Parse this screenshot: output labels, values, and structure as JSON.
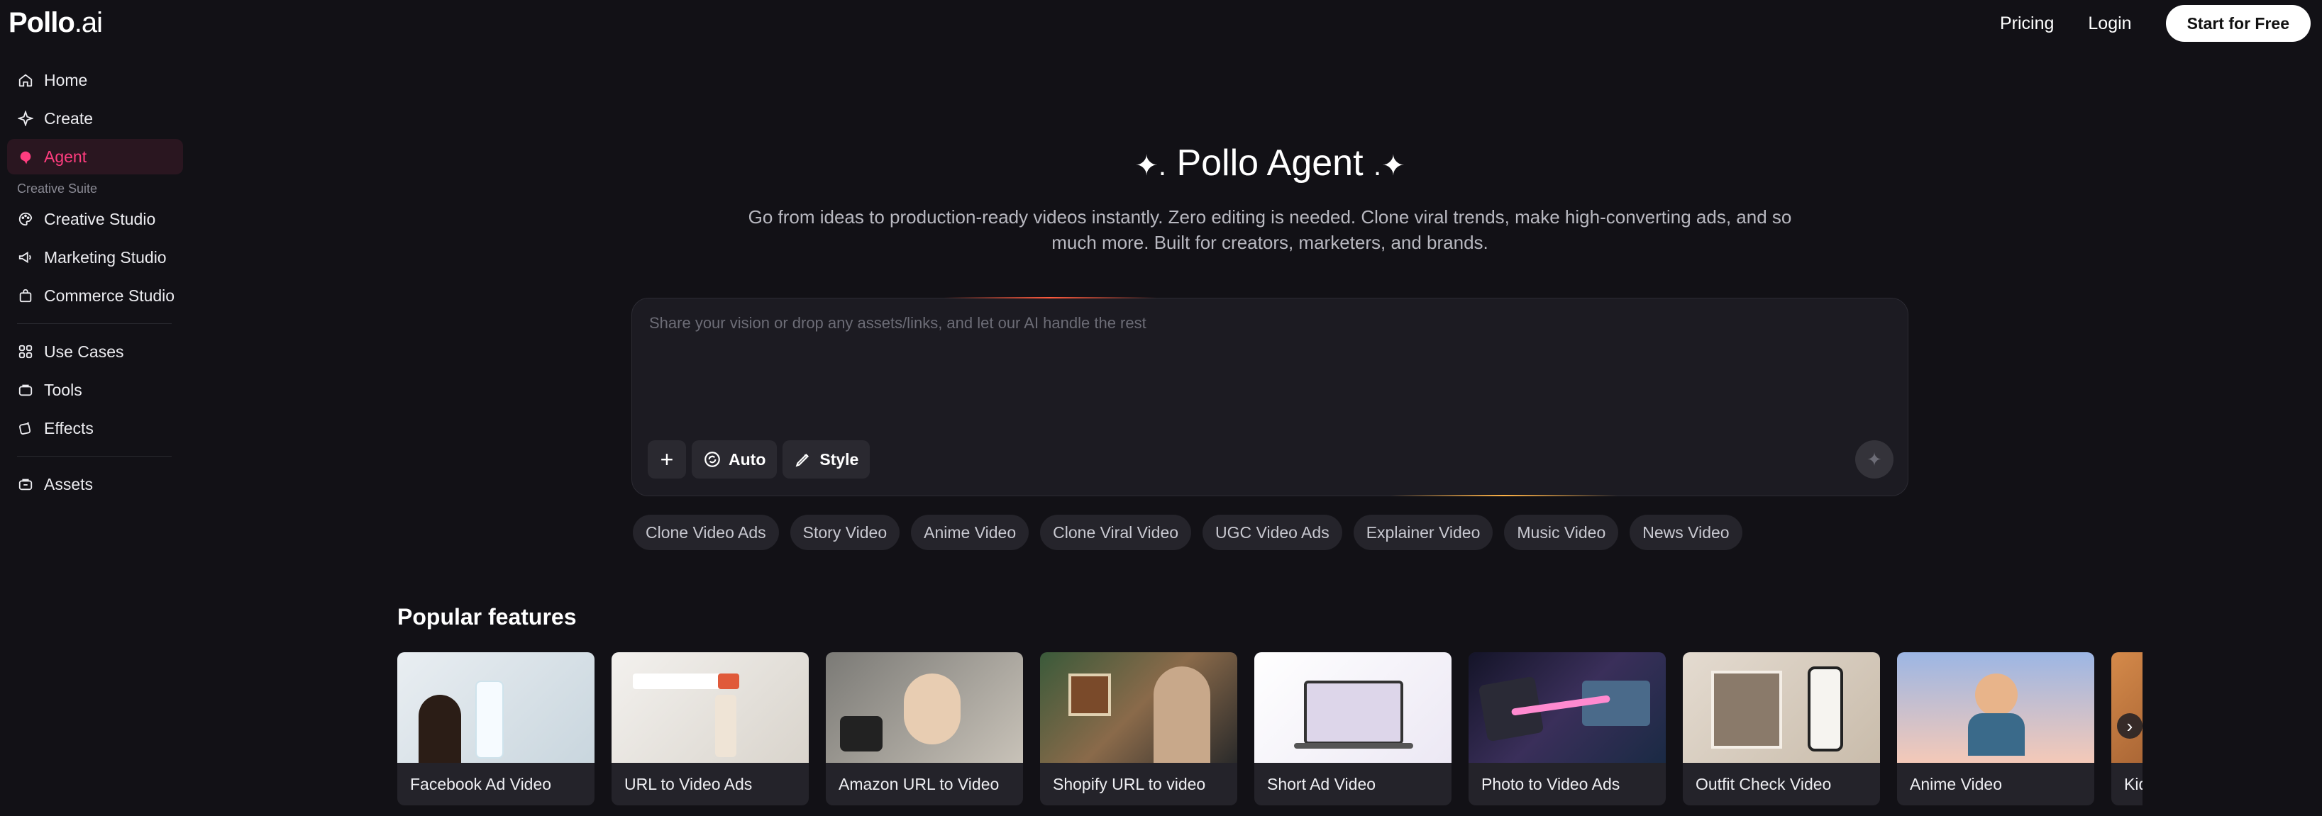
{
  "header": {
    "logo_main": "Pollo",
    "logo_suffix": ".ai",
    "pricing": "Pricing",
    "login": "Login",
    "start": "Start for Free"
  },
  "sidebar": {
    "items_top": [
      {
        "label": "Home",
        "icon": "home-icon"
      },
      {
        "label": "Create",
        "icon": "sparkle-icon"
      },
      {
        "label": "Agent",
        "icon": "agent-icon",
        "active": true
      }
    ],
    "section_label": "Creative Suite",
    "items_suite": [
      {
        "label": "Creative Studio",
        "icon": "palette-icon"
      },
      {
        "label": "Marketing Studio",
        "icon": "megaphone-icon"
      },
      {
        "label": "Commerce Studio",
        "icon": "bag-icon"
      }
    ],
    "items_tools": [
      {
        "label": "Use Cases",
        "icon": "grid-icon"
      },
      {
        "label": "Tools",
        "icon": "toolbox-icon"
      },
      {
        "label": "Effects",
        "icon": "effects-icon"
      }
    ],
    "items_bottom": [
      {
        "label": "Assets",
        "icon": "folder-icon"
      }
    ]
  },
  "hero": {
    "title": "Pollo Agent",
    "subtitle": "Go from ideas to production-ready videos instantly. Zero editing is needed. Clone viral trends, make high-converting ads, and so much more. Built for creators, marketers, and brands."
  },
  "prompt": {
    "placeholder": "Share your vision or drop any assets/links, and let our AI handle the rest",
    "add": "+",
    "auto": "Auto",
    "style": "Style"
  },
  "chips": [
    "Clone Video Ads",
    "Story Video",
    "Anime Video",
    "Clone Viral Video",
    "UGC Video Ads",
    "Explainer Video",
    "Music Video",
    "News Video"
  ],
  "popular": {
    "title": "Popular features",
    "cards": [
      "Facebook Ad Video",
      "URL to Video Ads",
      "Amazon URL to Video",
      "Shopify URL to video",
      "Short Ad Video",
      "Photo to Video Ads",
      "Outfit Check Video",
      "Anime Video",
      "Kid"
    ]
  },
  "colors": {
    "accent": "#ff3d7f",
    "background": "#121116"
  }
}
